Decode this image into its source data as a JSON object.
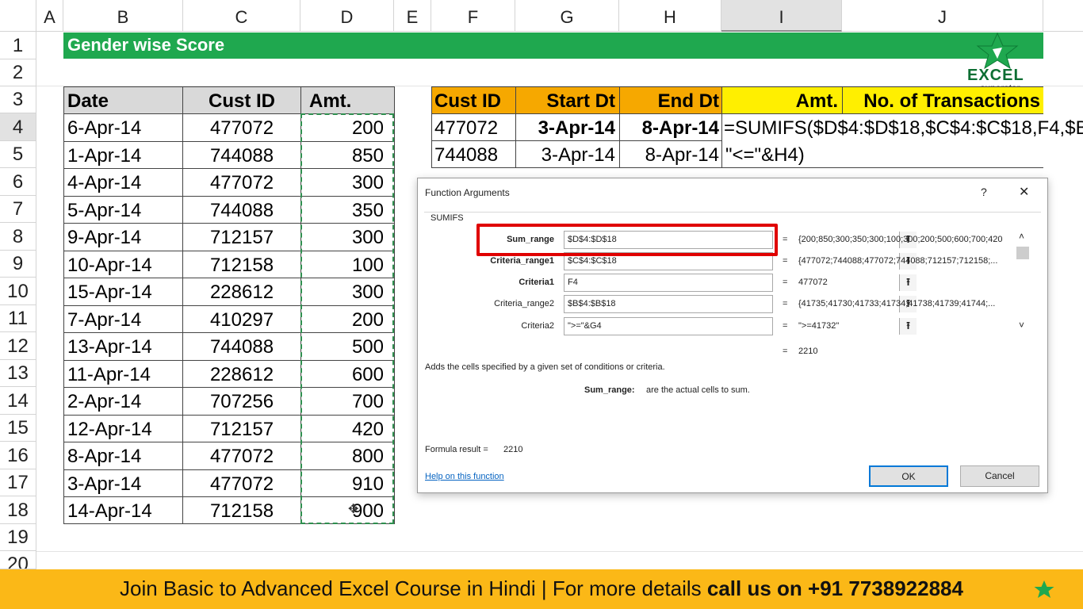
{
  "columns": [
    "A",
    "B",
    "C",
    "D",
    "E",
    "F",
    "G",
    "H",
    "I",
    "J"
  ],
  "rows": [
    "1",
    "2",
    "3",
    "4",
    "5",
    "6",
    "7",
    "8",
    "9",
    "10",
    "11",
    "12",
    "13",
    "14",
    "15",
    "16",
    "17",
    "18",
    "19",
    "20"
  ],
  "title": "Gender wise Score",
  "left_table": {
    "headers": [
      "Date",
      "Cust ID",
      "Amt."
    ],
    "rows": [
      [
        "6-Apr-14",
        "477072",
        "200"
      ],
      [
        "1-Apr-14",
        "744088",
        "850"
      ],
      [
        "4-Apr-14",
        "477072",
        "300"
      ],
      [
        "5-Apr-14",
        "744088",
        "350"
      ],
      [
        "9-Apr-14",
        "712157",
        "300"
      ],
      [
        "10-Apr-14",
        "712158",
        "100"
      ],
      [
        "15-Apr-14",
        "228612",
        "300"
      ],
      [
        "7-Apr-14",
        "410297",
        "200"
      ],
      [
        "13-Apr-14",
        "744088",
        "500"
      ],
      [
        "11-Apr-14",
        "228612",
        "600"
      ],
      [
        "2-Apr-14",
        "707256",
        "700"
      ],
      [
        "12-Apr-14",
        "712157",
        "420"
      ],
      [
        "8-Apr-14",
        "477072",
        "800"
      ],
      [
        "3-Apr-14",
        "477072",
        "910"
      ],
      [
        "14-Apr-14",
        "712158",
        "900"
      ]
    ]
  },
  "right_table": {
    "headers": [
      "Cust ID",
      "Start Dt",
      "End Dt",
      "Amt.",
      "No. of Transactions"
    ],
    "row1": [
      "477072",
      "3-Apr-14",
      "8-Apr-14",
      "=SUMIFS($D$4:$D$18,$C$4:$C$18,F4,$B$"
    ],
    "row2": [
      "744088",
      "3-Apr-14",
      "8-Apr-14",
      "\"<=\"&H4)"
    ]
  },
  "logo": {
    "brand": "EXCEL",
    "tag": "superstar"
  },
  "dialog": {
    "title": "Function Arguments",
    "help_glyph": "?",
    "close_glyph": "✕",
    "function_name": "SUMIFS",
    "args": [
      {
        "label": "Sum_range",
        "value": "$D$4:$D$18",
        "result": "{200;850;300;350;300;100;300;200;500;600;700;420"
      },
      {
        "label": "Criteria_range1",
        "value": "$C$4:$C$18",
        "result": "{477072;744088;477072;744088;712157;712158;..."
      },
      {
        "label": "Criteria1",
        "value": "F4",
        "result": "477072"
      },
      {
        "label": "Criteria_range2",
        "value": "$B$4:$B$18",
        "result": "{41735;41730;41733;41734;41738;41739;41744;..."
      },
      {
        "label": "Criteria2",
        "value": "\">=\"&G4",
        "result": "\">=41732\""
      }
    ],
    "equals": "=",
    "total": "2210",
    "description": "Adds the cells specified by a given set of conditions or criteria.",
    "arg_help_label": "Sum_range:",
    "arg_help_text": "are the actual cells to sum.",
    "formula_result_label": "Formula result =",
    "formula_result_value": "2210",
    "help_link": "Help on this function",
    "ok_label": "OK",
    "cancel_label": "Cancel"
  },
  "banner": {
    "text_plain": "Join Basic to Advanced Excel Course in Hindi | For more details ",
    "text_bold": "call us on +91 7738922884"
  },
  "colors": {
    "green": "#1fa84f",
    "orange": "#f6a800",
    "yellow": "#ffef00",
    "banner": "#fbb817",
    "highlight": "#e00000"
  }
}
